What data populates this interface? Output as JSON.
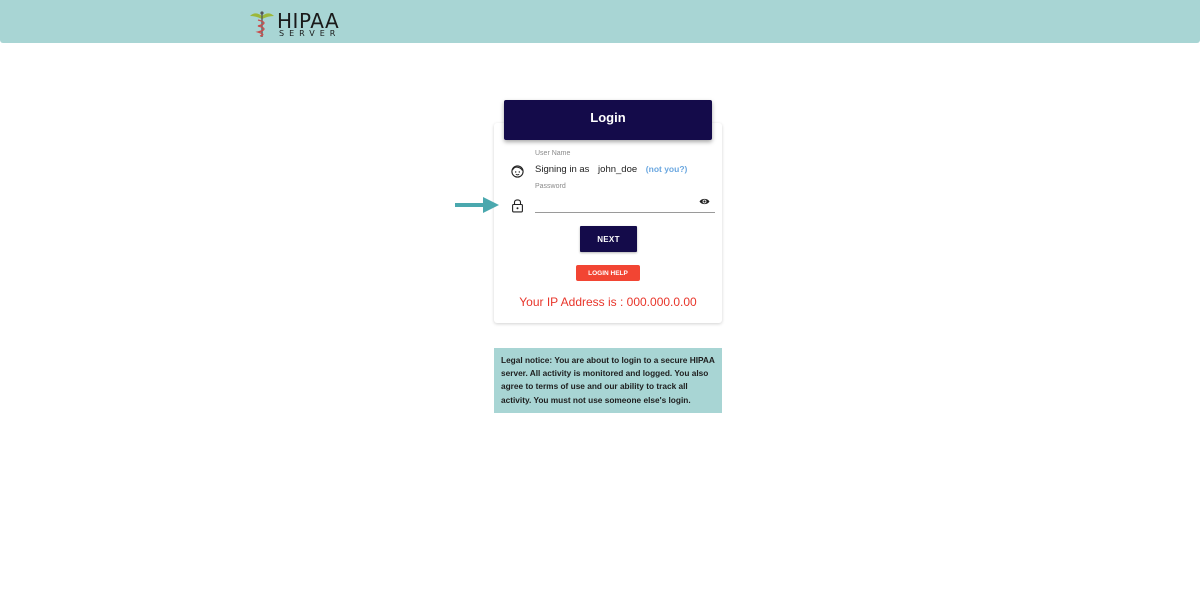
{
  "header": {
    "logo_title": "HIPAA",
    "logo_subtitle": "SERVER",
    "background_color": "#a8d5d4"
  },
  "login": {
    "title": "Login",
    "username_label": "User Name",
    "signing_in_prefix": "Signing in as",
    "username": "john_doe",
    "not_you_link": "(not you?)",
    "password_label": "Password",
    "password_value": "",
    "next_button": "NEXT",
    "help_button": "LOGIN HELP",
    "ip_text": "Your IP Address is : 000.000.0.00",
    "icons": {
      "user": "user-face-icon",
      "password": "lock-icon",
      "visibility": "eye-icon",
      "pointer": "arrow-right-icon"
    },
    "colors": {
      "primary": "#140b4a",
      "danger": "#f24533",
      "link": "#6aa7e0",
      "arrow": "#4aa8ae"
    }
  },
  "legal_notice": {
    "text": "Legal notice: You are about to login to a secure HIPAA server. All activity is monitored and logged. You also agree to terms of use and our ability to track all activity. You must not use someone else's login."
  }
}
